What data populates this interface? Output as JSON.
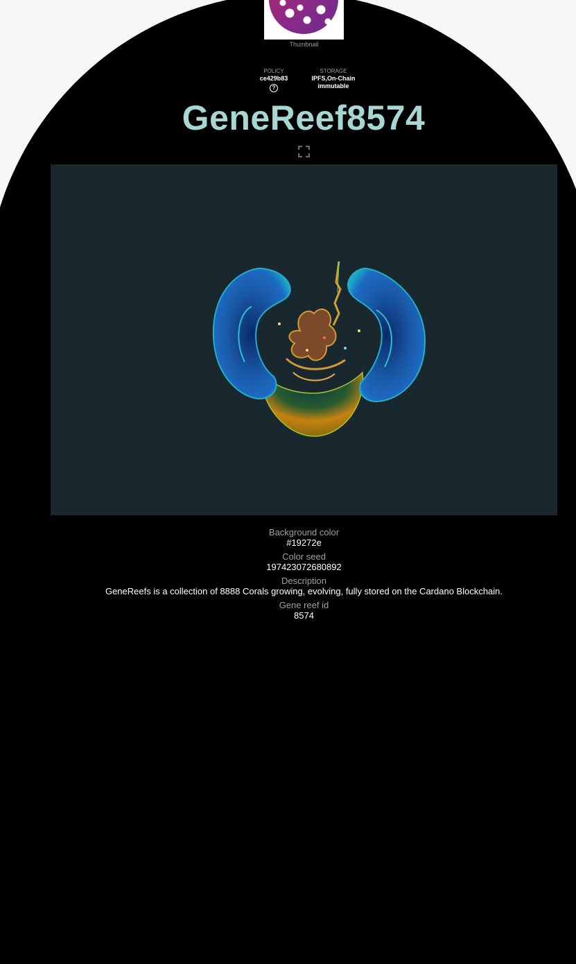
{
  "thumbnail": {
    "caption": "Thumbnail"
  },
  "meta": {
    "policy": {
      "label": "POLICY",
      "value": "ce429b83"
    },
    "storage": {
      "label": "STORAGE",
      "value": "IPFS,On-Chain",
      "note": "immutable"
    }
  },
  "title": "GeneReef8574",
  "icons": {
    "help": "help-circle-icon",
    "expand": "fullscreen-icon"
  },
  "artwork": {
    "background": "#19272e"
  },
  "attributes": [
    {
      "label": "Background color",
      "value": "#19272e"
    },
    {
      "label": "Color seed",
      "value": "197423072680892"
    },
    {
      "label": "Description",
      "value": "GeneReefs is a collection of 8888 Corals growing, evolving, fully stored on the Cardano Blockchain."
    },
    {
      "label": "Gene reef id",
      "value": "8574"
    }
  ],
  "colors": {
    "title": "#a8d6d2",
    "page": "#000000",
    "outer": "#f7f7f7"
  }
}
